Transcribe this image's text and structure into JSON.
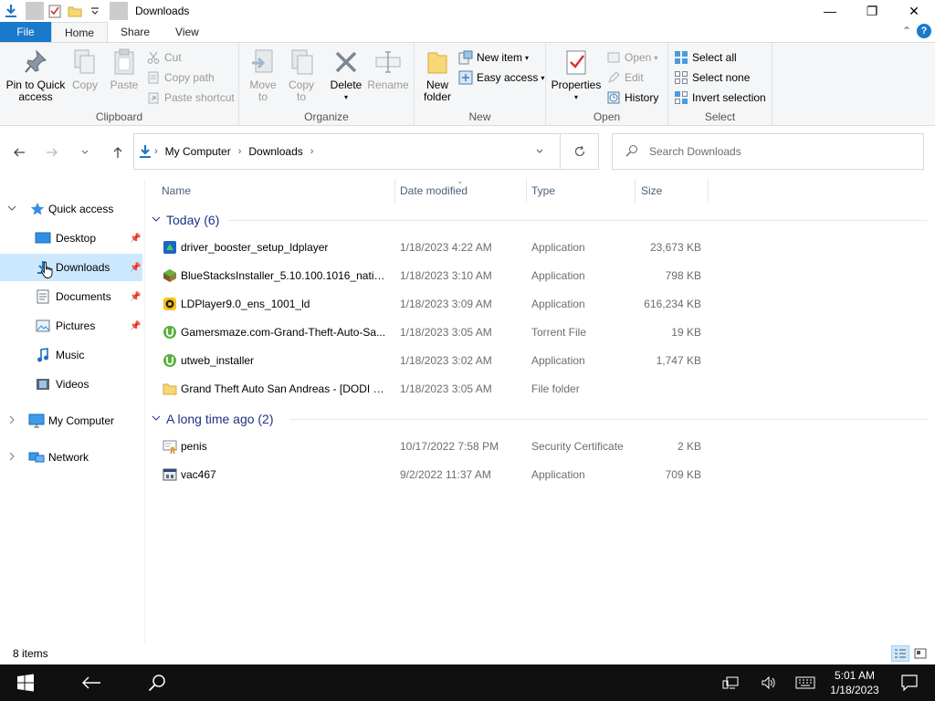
{
  "window": {
    "title": "Downloads",
    "minimize": "—",
    "maximize": "❐",
    "close": "✕"
  },
  "tabs": {
    "file": "File",
    "home": "Home",
    "share": "Share",
    "view": "View",
    "chevron": "⌃",
    "help": "?"
  },
  "ribbon": {
    "clipboard": {
      "label": "Clipboard",
      "pin": [
        "Pin to Quick",
        "access"
      ],
      "copy": "Copy",
      "paste": "Paste",
      "cut": "Cut",
      "copy_path": "Copy path",
      "paste_shortcut": "Paste shortcut"
    },
    "organize": {
      "label": "Organize",
      "move_to": [
        "Move",
        "to"
      ],
      "copy_to": [
        "Copy",
        "to"
      ],
      "delete": "Delete",
      "rename": "Rename"
    },
    "new": {
      "label": "New",
      "new_folder": [
        "New",
        "folder"
      ],
      "new_item": "New item",
      "easy_access": "Easy access"
    },
    "open": {
      "label": "Open",
      "properties": "Properties",
      "open": "Open",
      "edit": "Edit",
      "history": "History"
    },
    "select": {
      "label": "Select",
      "select_all": "Select all",
      "select_none": "Select none",
      "invert": "Invert selection"
    }
  },
  "address": {
    "crumbs": [
      "My Computer",
      "Downloads"
    ],
    "search_placeholder": "Search Downloads"
  },
  "nav": {
    "quick_access": "Quick access",
    "desktop": "Desktop",
    "downloads": "Downloads",
    "documents": "Documents",
    "pictures": "Pictures",
    "music": "Music",
    "videos": "Videos",
    "my_computer": "My Computer",
    "network": "Network"
  },
  "columns": {
    "name": "Name",
    "date": "Date modified",
    "type": "Type",
    "size": "Size"
  },
  "groups": {
    "today": "Today (6)",
    "long_ago": "A long time ago (2)"
  },
  "files": [
    {
      "name": "driver_booster_setup_ldplayer",
      "date": "1/18/2023 4:22 AM",
      "type": "Application",
      "size": "23,673 KB",
      "icon": "driver-booster-icon"
    },
    {
      "name": "BlueStacksInstaller_5.10.100.1016_native_...",
      "date": "1/18/2023 3:10 AM",
      "type": "Application",
      "size": "798 KB",
      "icon": "bluestacks-icon"
    },
    {
      "name": "LDPlayer9.0_ens_1001_ld",
      "date": "1/18/2023 3:09 AM",
      "type": "Application",
      "size": "616,234 KB",
      "icon": "ldplayer-icon"
    },
    {
      "name": "Gamersmaze.com-Grand-Theft-Auto-Sa...",
      "date": "1/18/2023 3:05 AM",
      "type": "Torrent File",
      "size": "19 KB",
      "icon": "utorrent-icon"
    },
    {
      "name": "utweb_installer",
      "date": "1/18/2023 3:02 AM",
      "type": "Application",
      "size": "1,747 KB",
      "icon": "utorrent-icon"
    },
    {
      "name": "Grand Theft Auto San Andreas - [DODI R...",
      "date": "1/18/2023 3:05 AM",
      "type": "File folder",
      "size": "",
      "icon": "folder-icon"
    },
    {
      "name": "penis",
      "date": "10/17/2022 7:58 PM",
      "type": "Security Certificate",
      "size": "2 KB",
      "icon": "certificate-icon"
    },
    {
      "name": "vac467",
      "date": "9/2/2022 11:37 AM",
      "type": "Application",
      "size": "709 KB",
      "icon": "application-icon"
    }
  ],
  "status": {
    "count": "8 items"
  },
  "taskbar": {
    "time": "5:01 AM",
    "date": "1/18/2023"
  },
  "colors": {
    "accent": "#1979ca",
    "selection": "#cce8ff",
    "group_header": "#1e3287",
    "taskbar": "#101010"
  }
}
